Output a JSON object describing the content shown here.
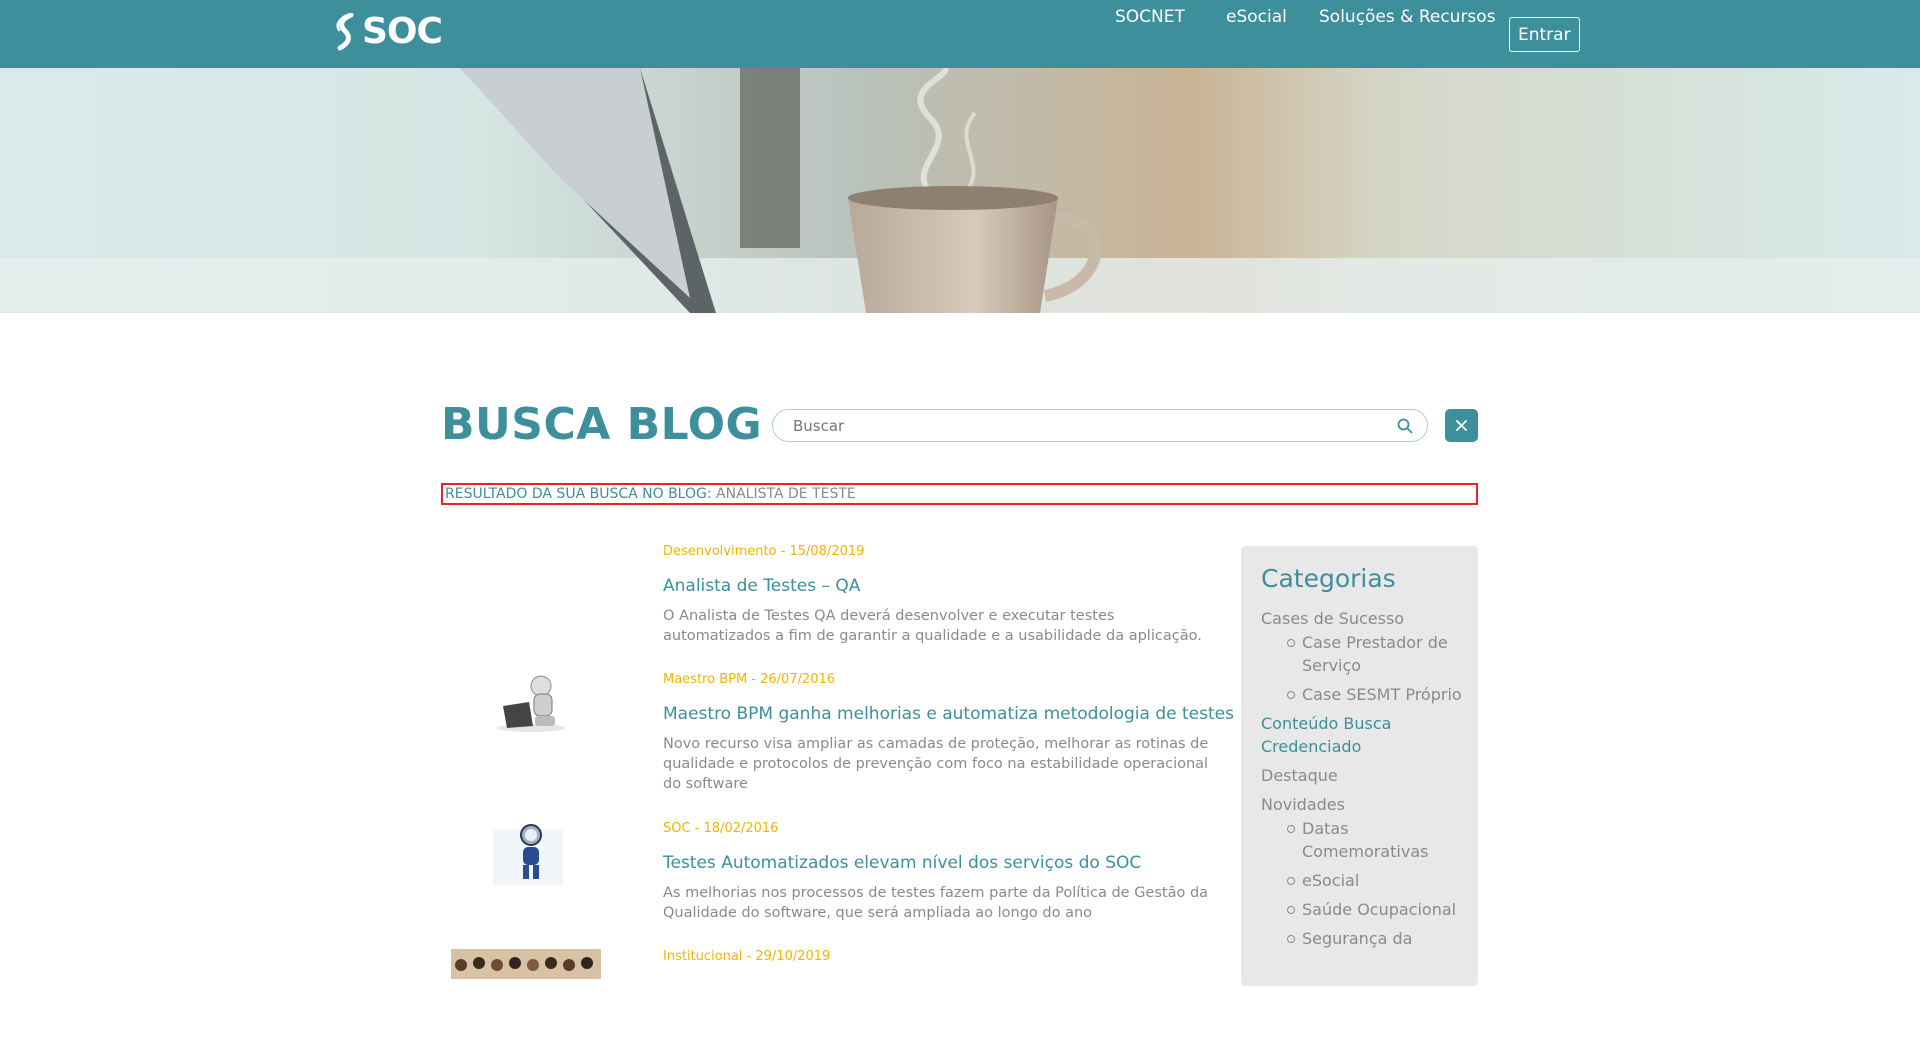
{
  "header": {
    "logo_text": "SOC",
    "nav": [
      "SOCNET",
      "eSocial",
      "Soluções & Recursos"
    ],
    "login_label": "Entrar"
  },
  "search": {
    "page_title": "BUSCA BLOG",
    "placeholder": "Buscar",
    "result_label": "Resultado da sua busca no blog:",
    "result_term": "Analista de Teste"
  },
  "posts": [
    {
      "meta": "Desenvolvimento - 15/08/2019",
      "title": "Analista de Testes – QA",
      "excerpt": "O Analista de Testes QA deverá desenvolver e executar testes automatizados a fim de garantir a qualidade e a usabilidade da aplicação.",
      "thumb": "none"
    },
    {
      "meta": "Maestro BPM - 26/07/2016",
      "title": "Maestro BPM ganha melhorias e automatiza metodologia de testes",
      "excerpt": "Novo recurso visa ampliar as camadas de proteção, melhorar as rotinas de qualidade e protocolos de prevenção com foco na estabilidade operacional do software",
      "thumb": "robot-with-laptop"
    },
    {
      "meta": "SOC - 18/02/2016",
      "title": "Testes Automatizados elevam nível dos serviços do SOC",
      "excerpt": "As melhorias nos processos de testes fazem parte da Política de Gestão da Qualidade do software, que será ampliada ao longo do ano",
      "thumb": "robot-with-magnifier"
    },
    {
      "meta": "Institucional - 29/10/2019",
      "title": "",
      "excerpt": "",
      "thumb": "group-photo"
    }
  ],
  "sidebar": {
    "title": "Categorias",
    "categories": [
      {
        "label": "Cases de Sucesso",
        "children": [
          "Case Prestador de Serviço",
          "Case SESMT Próprio"
        ]
      },
      {
        "label": "Conteúdo Busca Credenciado",
        "children": []
      },
      {
        "label": "Destaque",
        "children": []
      },
      {
        "label": "Novidades",
        "children": [
          "Datas Comemorativas",
          "eSocial",
          "Saúde Ocupacional",
          "Segurança da"
        ]
      }
    ]
  },
  "colors": {
    "brand_teal": "#3d8f9b",
    "meta_yellow": "#f0b400",
    "highlight_border": "#ee2222"
  }
}
